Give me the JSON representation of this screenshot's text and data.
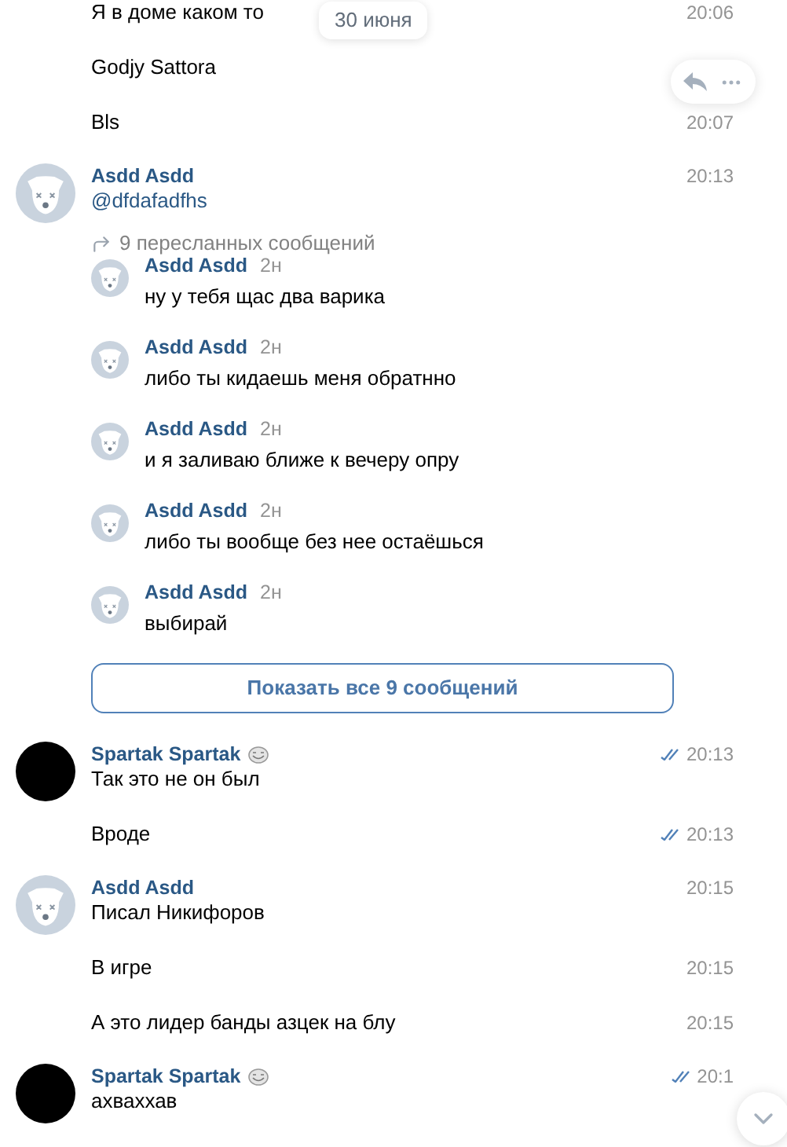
{
  "date_badge": "30 июня",
  "groups": [
    {
      "messages": [
        {
          "kind": "text",
          "text": "Я в доме каком то",
          "time": "20:06",
          "read": false
        },
        {
          "kind": "text",
          "text": "Godjy Sattora"
        },
        {
          "kind": "text",
          "text": "Bls",
          "time": "20:07",
          "read": false
        }
      ]
    },
    {
      "sender": "Asdd Asdd",
      "avatar": {
        "kind": "dog"
      },
      "sticker": false,
      "messages": [
        {
          "kind": "mention",
          "text": "@dfdafadfhs",
          "time": "20:13",
          "read": false,
          "forwarded": {
            "label": "9 пересланных сообщений",
            "items": [
              {
                "sender": "Asdd Asdd",
                "age": "2н",
                "text": "ну у тебя щас два варика"
              },
              {
                "sender": "Asdd Asdd",
                "age": "2н",
                "text": "либо ты кидаешь меня обратнно"
              },
              {
                "sender": "Asdd Asdd",
                "age": "2н",
                "text": "и я заливаю ближе к вечеру опру"
              },
              {
                "sender": "Asdd Asdd",
                "age": "2н",
                "text": "либо ты вообще без нее остаёшься"
              },
              {
                "sender": "Asdd Asdd",
                "age": "2н",
                "text": "выбирай"
              }
            ],
            "button": "Показать все 9 сообщений"
          }
        }
      ]
    },
    {
      "sender": "Spartak Spartak",
      "avatar": {
        "kind": "black"
      },
      "sticker": true,
      "messages": [
        {
          "kind": "text",
          "text": "Так это не он был",
          "time": "20:13",
          "read": true
        },
        {
          "kind": "text",
          "text": "Вроде",
          "time": "20:13",
          "read": true
        }
      ]
    },
    {
      "sender": "Asdd Asdd",
      "avatar": {
        "kind": "dog"
      },
      "sticker": false,
      "messages": [
        {
          "kind": "text",
          "text": "Писал Никифоров",
          "time": "20:15",
          "read": false
        },
        {
          "kind": "text",
          "text": "В игре",
          "time": "20:15",
          "read": false
        },
        {
          "kind": "text",
          "text": "А это лидер банды азцек на блу",
          "time": "20:15",
          "read": false
        }
      ]
    },
    {
      "sender": "Spartak Spartak",
      "avatar": {
        "kind": "black"
      },
      "sticker": true,
      "messages": [
        {
          "kind": "text",
          "text": "ахваххав",
          "time": "20:1",
          "read": true
        }
      ]
    }
  ]
}
